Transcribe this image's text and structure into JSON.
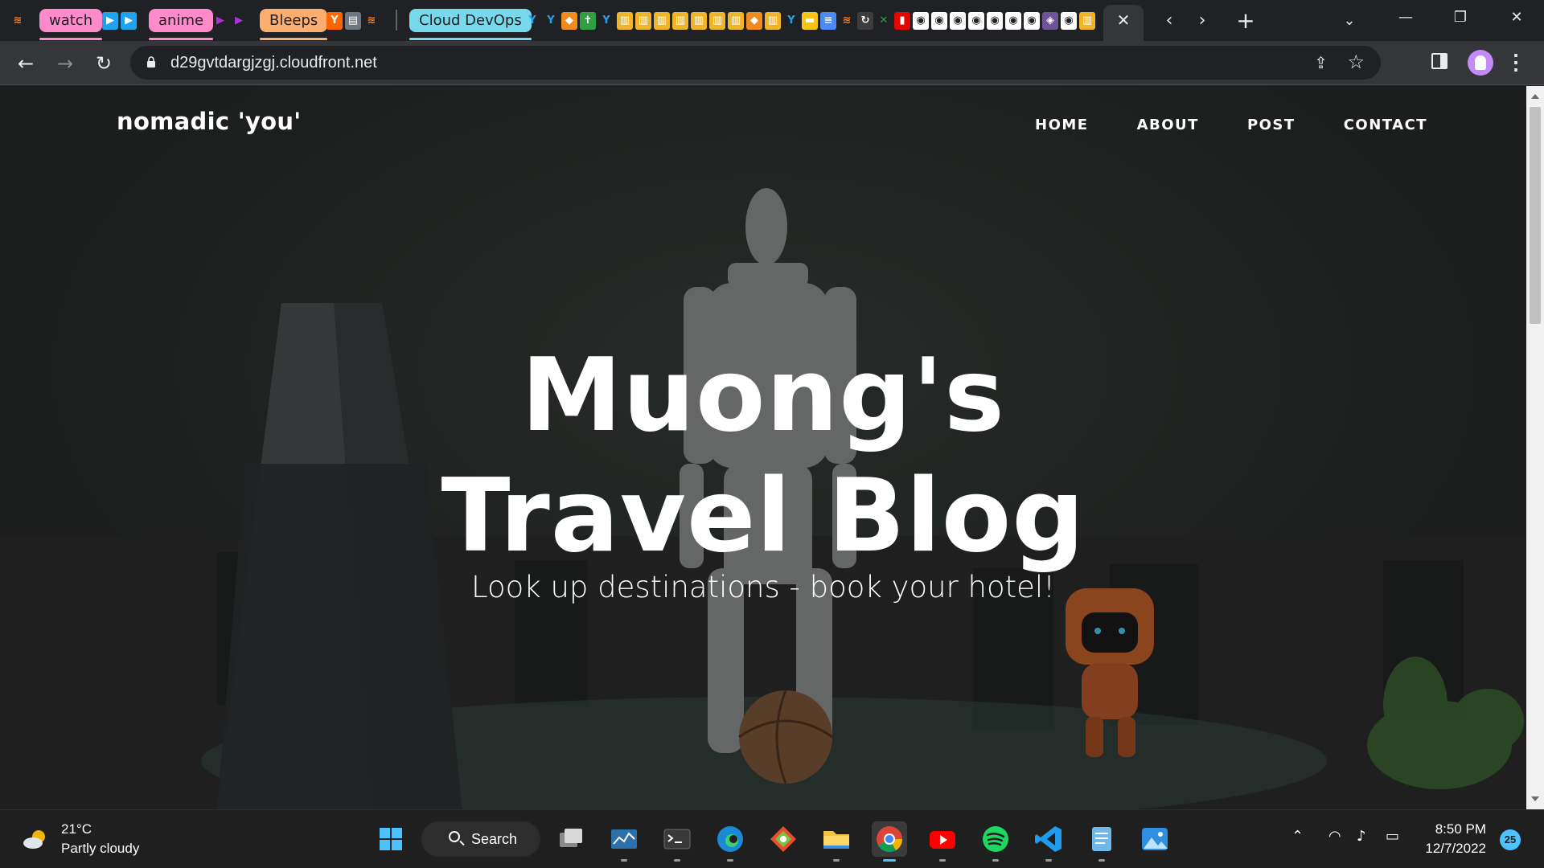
{
  "browser": {
    "tab_groups": [
      {
        "label": "watch"
      },
      {
        "label": "anime"
      },
      {
        "label": "Bleeps"
      },
      {
        "label": "Cloud DevOps"
      }
    ],
    "active_tab_close": "✕",
    "new_tab": "+",
    "url": "d29gvtdargjzgj.cloudfront.net"
  },
  "site": {
    "brand": "nomadic 'you'",
    "nav": [
      "HOME",
      "ABOUT",
      "POST",
      "CONTACT"
    ],
    "hero_title": "Muong's Travel Blog",
    "hero_subtitle": "Look up destinations - book your hotel!"
  },
  "taskbar": {
    "weather_temp": "21°C",
    "weather_condition": "Partly cloudy",
    "search_label": "Search",
    "time": "8:50 PM",
    "date": "12/7/2022",
    "notification_count": "25",
    "apps": [
      "windows-start",
      "task-view",
      "system-monitor",
      "terminal",
      "edge",
      "git",
      "file-explorer",
      "chrome",
      "youtube",
      "spotify",
      "vscode",
      "notepad",
      "photos"
    ]
  },
  "colors": {
    "tab_group_pink": "#ff8bcb",
    "tab_group_orange": "#fcad70",
    "tab_group_cyan": "#78d9ec",
    "accent_blue": "#4cc2ff"
  }
}
